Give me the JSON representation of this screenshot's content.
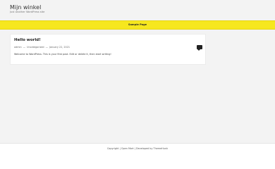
{
  "site": {
    "title": "Mijn winkel",
    "tagline": "Just another WordPress site"
  },
  "nav": {
    "items": [
      {
        "label": "Sample Page"
      }
    ]
  },
  "post": {
    "title": "Hello world!",
    "author": "admin",
    "category": "Uncategorized",
    "date": "January 22, 2021",
    "separator": "—",
    "excerpt": "Welcome to WordPress. This is your first post. Edit or delete it, then start writing!"
  },
  "footer": {
    "copyright": "Copyright",
    "separator1": "|",
    "theme_name": "Open Mart",
    "separator2": "|",
    "developed_by": "Developed by ThemeHunk"
  }
}
